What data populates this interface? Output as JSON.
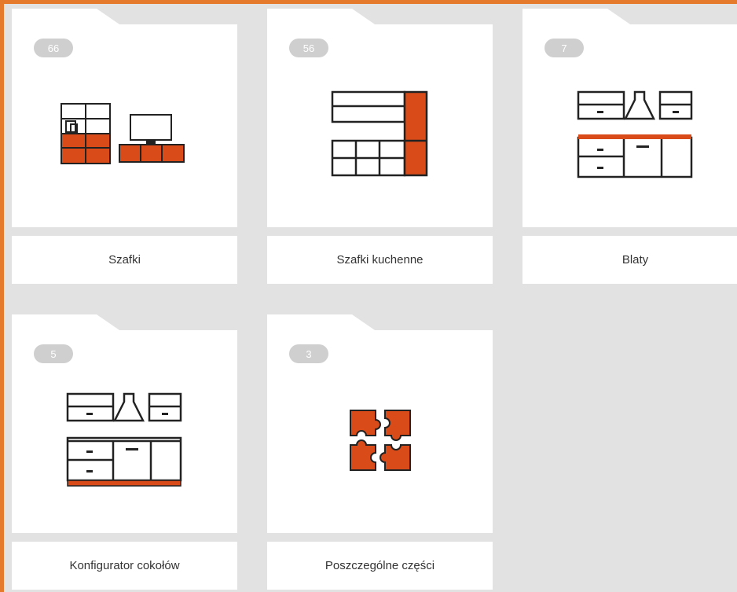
{
  "colors": {
    "accent": "#e57a2c",
    "icon_fill": "#d94c1a",
    "badge": "#cfcfcf",
    "background": "#e2e2e2"
  },
  "categories": [
    {
      "label": "Szafki",
      "count": "66",
      "icon": "living-room-cabinets-icon"
    },
    {
      "label": "Szafki kuchenne",
      "count": "56",
      "icon": "kitchen-cabinets-icon"
    },
    {
      "label": "Blaty",
      "count": "7",
      "icon": "countertop-icon"
    },
    {
      "label": "Konfigurator cokołów",
      "count": "5",
      "icon": "plinth-configurator-icon"
    },
    {
      "label": "Poszczególne części",
      "count": "3",
      "icon": "puzzle-parts-icon"
    }
  ]
}
